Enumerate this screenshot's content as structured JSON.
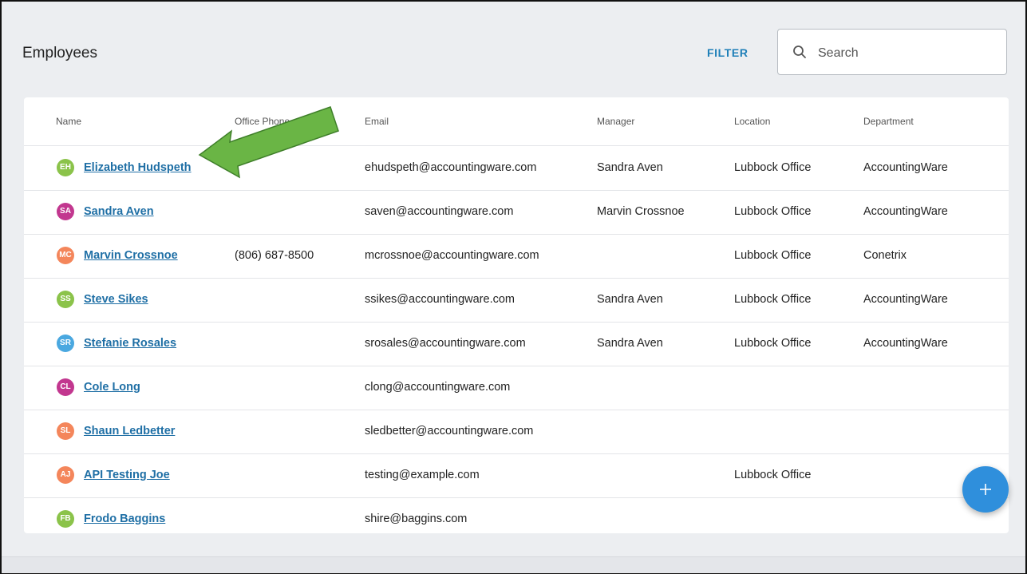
{
  "page": {
    "title": "Employees",
    "filter_label": "FILTER"
  },
  "search": {
    "placeholder": "Search",
    "icon": "search-icon"
  },
  "table": {
    "columns": [
      "Name",
      "Office Phone",
      "Email",
      "Manager",
      "Location",
      "Department"
    ],
    "rows": [
      {
        "initials": "EH",
        "avatar_color": "#8bc34a",
        "name": "Elizabeth Hudspeth",
        "phone": "",
        "email": "ehudspeth@accountingware.com",
        "manager": "Sandra Aven",
        "location": "Lubbock Office",
        "department": "AccountingWare"
      },
      {
        "initials": "SA",
        "avatar_color": "#c2378f",
        "name": "Sandra Aven",
        "phone": "",
        "email": "saven@accountingware.com",
        "manager": "Marvin Crossnoe",
        "location": "Lubbock Office",
        "department": "AccountingWare"
      },
      {
        "initials": "MC",
        "avatar_color": "#f4865b",
        "name": "Marvin Crossnoe",
        "phone": "(806) 687-8500",
        "email": "mcrossnoe@accountingware.com",
        "manager": "",
        "location": "Lubbock Office",
        "department": "Conetrix"
      },
      {
        "initials": "SS",
        "avatar_color": "#8bc34a",
        "name": "Steve Sikes",
        "phone": "",
        "email": "ssikes@accountingware.com",
        "manager": "Sandra Aven",
        "location": "Lubbock Office",
        "department": "AccountingWare"
      },
      {
        "initials": "SR",
        "avatar_color": "#4aa8e0",
        "name": "Stefanie Rosales",
        "phone": "",
        "email": "srosales@accountingware.com",
        "manager": "Sandra Aven",
        "location": "Lubbock Office",
        "department": "AccountingWare"
      },
      {
        "initials": "CL",
        "avatar_color": "#c2378f",
        "name": "Cole Long",
        "phone": "",
        "email": "clong@accountingware.com",
        "manager": "",
        "location": "",
        "department": ""
      },
      {
        "initials": "SL",
        "avatar_color": "#f4865b",
        "name": "Shaun Ledbetter",
        "phone": "",
        "email": "sledbetter@accountingware.com",
        "manager": "",
        "location": "",
        "department": ""
      },
      {
        "initials": "AJ",
        "avatar_color": "#f4865b",
        "name": "API Testing Joe",
        "phone": "",
        "email": "testing@example.com",
        "manager": "",
        "location": "Lubbock Office",
        "department": ""
      },
      {
        "initials": "FB",
        "avatar_color": "#8bc34a",
        "name": "Frodo Baggins",
        "phone": "",
        "email": "shire@baggins.com",
        "manager": "",
        "location": "",
        "department": ""
      }
    ]
  },
  "fab": {
    "icon": "plus-icon"
  },
  "annotation": {
    "icon": "arrow-icon",
    "color": "#6ab545"
  },
  "colors": {
    "link": "#1f6fa5",
    "accent": "#1e7fb8",
    "fab": "#2f8fdc",
    "background": "#eceef1"
  }
}
